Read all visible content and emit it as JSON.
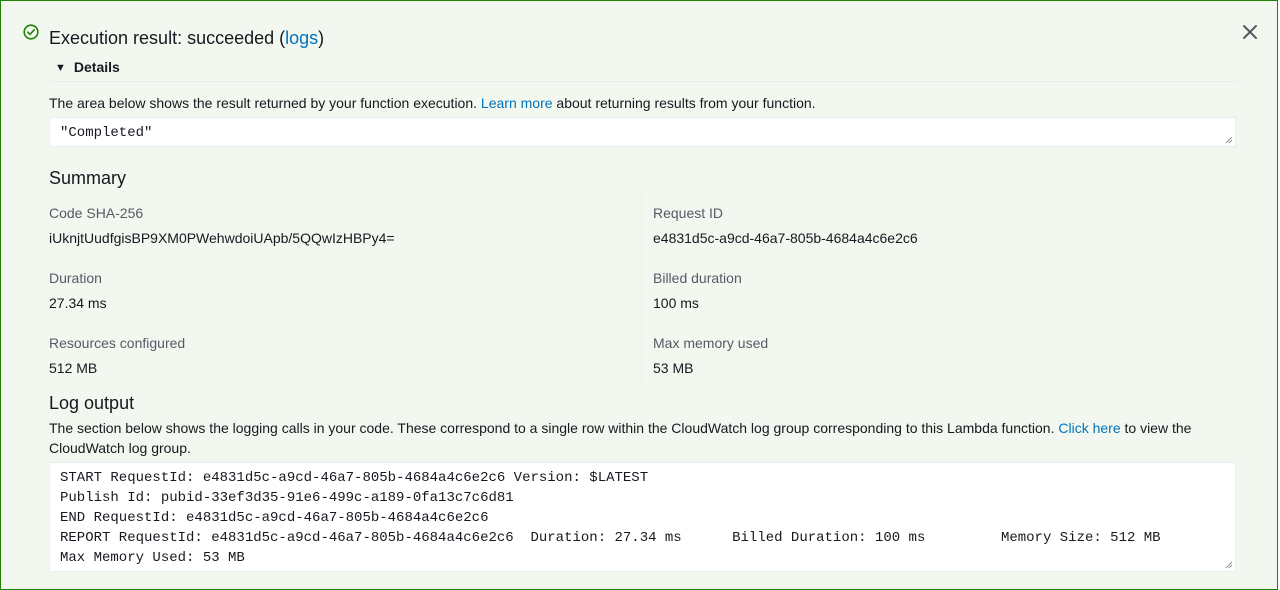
{
  "header": {
    "title_prefix": "Execution result: succeeded (",
    "logs_link": "logs",
    "title_suffix": ")",
    "status_icon": "check-circle-icon",
    "close_icon": "close-icon",
    "success_color": "#1d8102"
  },
  "details": {
    "toggle_label": "Details",
    "description_prefix": "The area below shows the result returned by your function execution. ",
    "learn_more": "Learn more",
    "description_suffix": " about returning results from your function.",
    "result_value": "\"Completed\""
  },
  "summary": {
    "heading": "Summary",
    "code_sha_label": "Code SHA-256",
    "code_sha_value": "iUknjtUudfgisBP9XM0PWehwdoiUApb/5QQwIzHBPy4=",
    "request_id_label": "Request ID",
    "request_id_value": "e4831d5c-a9cd-46a7-805b-4684a4c6e2c6",
    "duration_label": "Duration",
    "duration_value": "27.34 ms",
    "billed_duration_label": "Billed duration",
    "billed_duration_value": "100 ms",
    "resources_label": "Resources configured",
    "resources_value": "512 MB",
    "max_memory_label": "Max memory used",
    "max_memory_value": "53 MB"
  },
  "log": {
    "heading": "Log output",
    "description_prefix": "The section below shows the logging calls in your code. These correspond to a single row within the CloudWatch log group corresponding to this Lambda function. ",
    "click_here": "Click here",
    "description_suffix": " to view the CloudWatch log group.",
    "output": "START RequestId: e4831d5c-a9cd-46a7-805b-4684a4c6e2c6 Version: $LATEST\nPublish Id: pubid-33ef3d35-91e6-499c-a189-0fa13c7c6d81\nEND RequestId: e4831d5c-a9cd-46a7-805b-4684a4c6e2c6\nREPORT RequestId: e4831d5c-a9cd-46a7-805b-4684a4c6e2c6  Duration: 27.34 ms      Billed Duration: 100 ms         Memory Size: 512 MB\nMax Memory Used: 53 MB"
  }
}
